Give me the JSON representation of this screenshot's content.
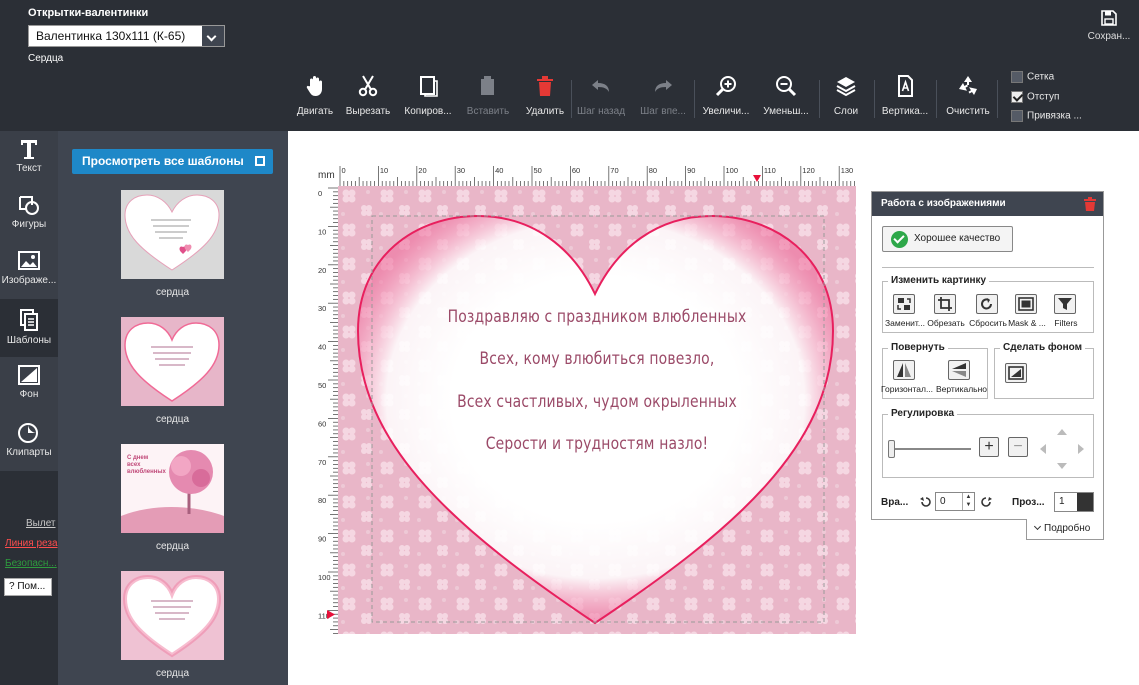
{
  "app": {
    "title": "Открытки-валентинки",
    "product": "Валентинка 130х111 (К-65)",
    "subtitle": "Сердца",
    "save_label": "Сохран..."
  },
  "toolbar": {
    "move": "Двигать",
    "cut": "Вырезать",
    "copy": "Копиров...",
    "paste": "Вставить",
    "delete": "Удалить",
    "undo": "Шаг назад",
    "redo": "Шаг впе...",
    "zoom_in": "Увеличи...",
    "zoom_out": "Уменьш...",
    "layers": "Слои",
    "vertical": "Вертика...",
    "clear": "Очистить"
  },
  "options": {
    "grid": "Сетка",
    "margin": "Отступ",
    "snap": "Привязка ..."
  },
  "leftnav": {
    "text": "Текст",
    "shapes": "Фигуры",
    "images": "Изображе...",
    "templates": "Шаблоны",
    "background": "Фон",
    "cliparts": "Клипарты"
  },
  "legend": {
    "bleed": "Вылет",
    "cutline": "Линия реза",
    "safe": "Безопасн...",
    "help": "? Пом..."
  },
  "templates": {
    "view_all": "Просмотреть все шаблоны",
    "items": [
      {
        "caption": "сердца",
        "heading": ""
      },
      {
        "caption": "сердца",
        "heading": ""
      },
      {
        "caption": "сердца",
        "heading": "С днем\nвсех\nвлюбленных"
      },
      {
        "caption": "сердца",
        "heading": ""
      }
    ]
  },
  "canvas": {
    "unit": "mm",
    "top_ticks": [
      "0",
      "10",
      "20",
      "30",
      "40",
      "50",
      "60",
      "70",
      "80",
      "90",
      "100",
      "110",
      "120",
      "130"
    ],
    "left_ticks": [
      "0",
      "10",
      "20",
      "30",
      "40",
      "50",
      "60",
      "70",
      "80",
      "90",
      "100",
      "110"
    ],
    "verse": [
      "Поздравляю с праздником влюбленных",
      "Всех, кому влюбиться повезло,",
      "Всех счастливых, чудом окрыленных",
      "Серости и трудностям назло!"
    ]
  },
  "image_panel": {
    "title": "Работа с изображениями",
    "quality": "Хорошее качество",
    "change_group": "Изменить картинку",
    "change_buttons": [
      "Заменит...",
      "Обрезать",
      "Сбросить",
      "Mask & ...",
      "Filters"
    ],
    "rotate_group": "Повернуть",
    "rotate_buttons": [
      "Горизонтал...",
      "Вертикально"
    ],
    "background_group": "Сделать фоном",
    "adjust_group": "Регулировка",
    "rotation_label": "Вра...",
    "rotation_value": "0",
    "opacity_label": "Проз...",
    "opacity_value": "1",
    "more": "Подробно"
  }
}
